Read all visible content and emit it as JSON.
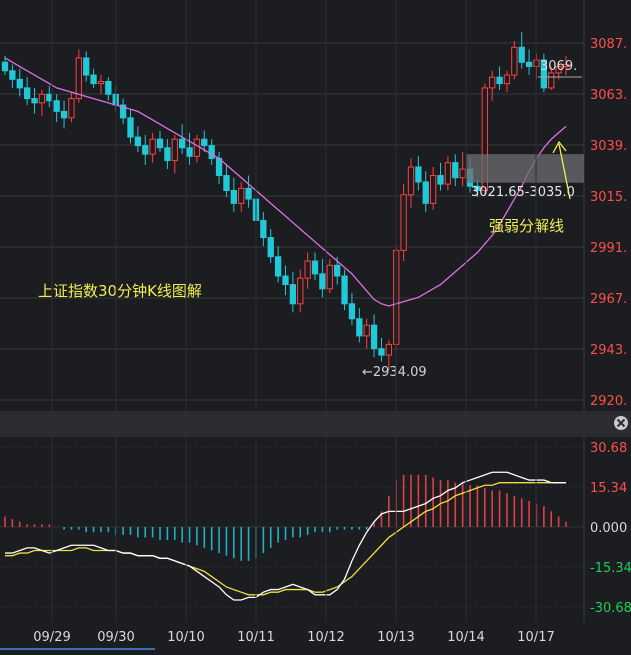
{
  "chart_data": [
    {
      "type": "candlestick",
      "title": "上证指数30分钟K线图解",
      "y_ticks": [
        "3087.",
        "3063.",
        "3039.",
        "3015.",
        "2991.",
        "2967.",
        "2943.",
        "2920."
      ],
      "ylim": [
        2920,
        3100
      ],
      "dates": [
        "09/29",
        "09/30",
        "10/10",
        "10/11",
        "10/12",
        "10/13",
        "10/14",
        "10/17"
      ],
      "ohlc": [
        [
          3078,
          3081,
          3072,
          3074
        ],
        [
          3074,
          3077,
          3066,
          3070
        ],
        [
          3070,
          3075,
          3062,
          3066
        ],
        [
          3066,
          3071,
          3058,
          3061
        ],
        [
          3061,
          3066,
          3054,
          3059
        ],
        [
          3059,
          3065,
          3053,
          3063
        ],
        [
          3063,
          3067,
          3057,
          3060
        ],
        [
          3060,
          3063,
          3050,
          3055
        ],
        [
          3055,
          3060,
          3047,
          3052
        ],
        [
          3052,
          3064,
          3050,
          3061
        ],
        [
          3061,
          3084,
          3059,
          3080
        ],
        [
          3080,
          3083,
          3069,
          3072
        ],
        [
          3072,
          3075,
          3066,
          3068
        ],
        [
          3068,
          3072,
          3063,
          3069
        ],
        [
          3069,
          3071,
          3060,
          3063
        ],
        [
          3063,
          3067,
          3055,
          3058
        ],
        [
          3058,
          3061,
          3049,
          3052
        ],
        [
          3052,
          3056,
          3040,
          3043
        ],
        [
          3043,
          3048,
          3036,
          3039
        ],
        [
          3039,
          3044,
          3030,
          3035
        ],
        [
          3035,
          3045,
          3031,
          3042
        ],
        [
          3042,
          3046,
          3036,
          3038
        ],
        [
          3038,
          3042,
          3028,
          3032
        ],
        [
          3032,
          3044,
          3026,
          3042
        ],
        [
          3042,
          3049,
          3035,
          3038
        ],
        [
          3038,
          3045,
          3030,
          3034
        ],
        [
          3034,
          3044,
          3031,
          3042
        ],
        [
          3042,
          3046,
          3036,
          3039
        ],
        [
          3039,
          3042,
          3030,
          3033
        ],
        [
          3033,
          3036,
          3021,
          3025
        ],
        [
          3025,
          3030,
          3015,
          3018
        ],
        [
          3018,
          3024,
          3008,
          3012
        ],
        [
          3012,
          3022,
          3008,
          3019
        ],
        [
          3019,
          3025,
          3010,
          3014
        ],
        [
          3014,
          3018,
          3001,
          3004
        ],
        [
          3004,
          3008,
          2992,
          2996
        ],
        [
          2996,
          3000,
          2984,
          2987
        ],
        [
          2987,
          2992,
          2975,
          2978
        ],
        [
          2978,
          2983,
          2969,
          2974
        ],
        [
          2974,
          2980,
          2961,
          2965
        ],
        [
          2965,
          2981,
          2961,
          2977
        ],
        [
          2977,
          2989,
          2972,
          2985
        ],
        [
          2985,
          2989,
          2976,
          2979
        ],
        [
          2979,
          2986,
          2968,
          2972
        ],
        [
          2972,
          2986,
          2970,
          2983
        ],
        [
          2983,
          2987,
          2974,
          2978
        ],
        [
          2978,
          2981,
          2962,
          2965
        ],
        [
          2965,
          2970,
          2955,
          2958
        ],
        [
          2958,
          2963,
          2947,
          2950
        ],
        [
          2950,
          2958,
          2944,
          2955
        ],
        [
          2955,
          2960,
          2940,
          2944
        ],
        [
          2944,
          2949,
          2938,
          2941
        ],
        [
          2941,
          2948,
          2934,
          2946
        ],
        [
          2946,
          2993,
          2943,
          2990
        ],
        [
          2990,
          3021,
          2985,
          3016
        ],
        [
          3016,
          3033,
          3010,
          3029
        ],
        [
          3029,
          3034,
          3018,
          3022
        ],
        [
          3022,
          3027,
          3008,
          3012
        ],
        [
          3012,
          3029,
          3009,
          3025
        ],
        [
          3025,
          3031,
          3018,
          3021
        ],
        [
          3021,
          3034,
          3018,
          3031
        ],
        [
          3031,
          3035,
          3020,
          3024
        ],
        [
          3024,
          3036,
          3020,
          3028
        ],
        [
          3028,
          3034,
          3017,
          3020
        ],
        [
          3020,
          3023,
          3015,
          3018
        ],
        [
          3018,
          3068,
          3016,
          3066
        ],
        [
          3066,
          3074,
          3060,
          3071
        ],
        [
          3071,
          3076,
          3065,
          3068
        ],
        [
          3068,
          3074,
          3064,
          3072
        ],
        [
          3072,
          3088,
          3070,
          3085
        ],
        [
          3085,
          3092,
          3075,
          3078
        ],
        [
          3078,
          3084,
          3072,
          3076
        ],
        [
          3076,
          3082,
          3070,
          3079
        ],
        [
          3079,
          3082,
          3064,
          3066
        ],
        [
          3066,
          3076,
          3065,
          3073
        ],
        [
          3073,
          3078,
          3070,
          3076
        ],
        [
          3076,
          3081,
          3072,
          3077
        ]
      ],
      "ma": [
        3080,
        3078,
        3076,
        3074,
        3072,
        3070,
        3068,
        3066,
        3065,
        3064,
        3063,
        3062,
        3061,
        3060,
        3059,
        3058,
        3057,
        3056,
        3055,
        3053,
        3051,
        3049,
        3047,
        3045,
        3043,
        3041,
        3039,
        3037,
        3035,
        3033,
        3030,
        3027,
        3024,
        3021,
        3018,
        3015,
        3012,
        3009,
        3006,
        3003,
        3000,
        2997,
        2994,
        2991,
        2988,
        2985,
        2982,
        2979,
        2975,
        2971,
        2967,
        2965,
        2964,
        2965,
        2966,
        2967,
        2968,
        2970,
        2972,
        2974,
        2977,
        2980,
        2983,
        2986,
        2989,
        2993,
        2997,
        3002,
        3008,
        3014,
        3020,
        3027,
        3033,
        3038,
        3042,
        3045,
        3048
      ],
      "annotations": {
        "low_label": "←2934.09",
        "last_price_label": "3069.",
        "zone_label": "3021.65-3035.0",
        "zone_low": 3021.65,
        "zone_high": 3035.0,
        "divider_label": "强弱分解线"
      },
      "colors": {
        "up": "#ff4040",
        "down": "#20c8d8",
        "ma": "#e070e0"
      }
    },
    {
      "type": "macd",
      "y_ticks": [
        "30.68",
        "15.34",
        "0.000",
        "-15.34",
        "-30.68"
      ],
      "ylim": [
        -30.68,
        30.68
      ],
      "hist": [
        4,
        3,
        2,
        1,
        1,
        1,
        1,
        0,
        -1,
        -1,
        -1,
        -2,
        -2,
        -2,
        -2,
        -3,
        -3,
        -3,
        -4,
        -4,
        -4,
        -5,
        -5,
        -5,
        -6,
        -6,
        -7,
        -8,
        -9,
        -10,
        -11,
        -12,
        -13,
        -13,
        -12,
        -10,
        -8,
        -6,
        -5,
        -4,
        -4,
        -3,
        -2,
        -2,
        -2,
        -1,
        -1,
        -1,
        -1,
        -1,
        2,
        6,
        12,
        18,
        20,
        20,
        20,
        20,
        19,
        18,
        18,
        17,
        17,
        16,
        16,
        15,
        14,
        14,
        13,
        12,
        11,
        10,
        9,
        8,
        6,
        4,
        2
      ],
      "dif": [
        -10,
        -10,
        -9,
        -8,
        -8,
        -9,
        -10,
        -9,
        -8,
        -7,
        -7,
        -7,
        -7,
        -8,
        -9,
        -9,
        -10,
        -10,
        -11,
        -11,
        -11,
        -12,
        -12,
        -13,
        -14,
        -15,
        -17,
        -19,
        -21,
        -23,
        -26,
        -28,
        -28,
        -27,
        -27,
        -25,
        -24,
        -24,
        -23,
        -22,
        -23,
        -24,
        -26,
        -26,
        -26,
        -24,
        -20,
        -13,
        -7,
        -2,
        2,
        5,
        6,
        6,
        6,
        7,
        8,
        9,
        11,
        12,
        14,
        15,
        17,
        18,
        19,
        20,
        21,
        21,
        21,
        20,
        19,
        18,
        18,
        18,
        17,
        17,
        17
      ],
      "dea": [
        -11,
        -11,
        -10,
        -10,
        -9,
        -9,
        -9,
        -9,
        -9,
        -9,
        -8,
        -8,
        -9,
        -9,
        -9,
        -9,
        -10,
        -10,
        -11,
        -11,
        -11,
        -12,
        -12,
        -13,
        -14,
        -15,
        -16,
        -17,
        -19,
        -21,
        -23,
        -24,
        -25,
        -26,
        -26,
        -26,
        -25,
        -25,
        -24,
        -24,
        -24,
        -24,
        -25,
        -25,
        -24,
        -23,
        -21,
        -19,
        -16,
        -13,
        -10,
        -7,
        -4,
        -2,
        0,
        2,
        4,
        6,
        7,
        9,
        10,
        12,
        13,
        14,
        15,
        16,
        16,
        17,
        17,
        17,
        17,
        17,
        17,
        17,
        17,
        17,
        17
      ],
      "colors": {
        "dif": "#ffffff",
        "dea": "#f0e040",
        "pos": "#e04040",
        "neg": "#20b0c8"
      }
    }
  ]
}
